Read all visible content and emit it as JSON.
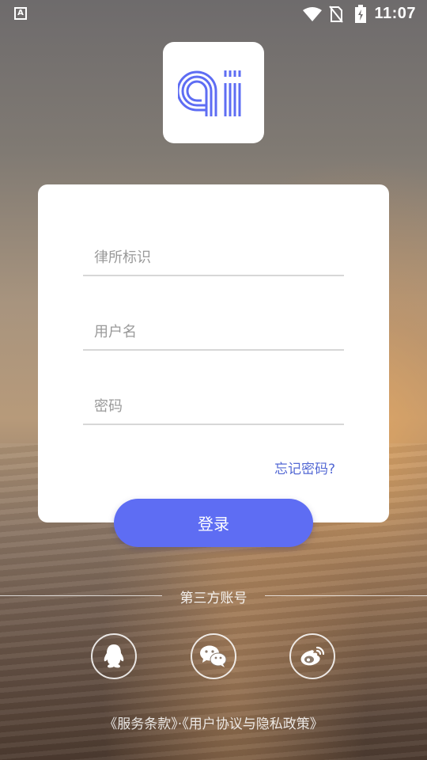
{
  "status_bar": {
    "notification_icon": "a-icon",
    "time": "11:07",
    "icons": [
      "wifi-icon",
      "no-sim-icon",
      "battery-charging-icon"
    ]
  },
  "logo": {
    "icon": "ai-logo-icon",
    "brand_color": "#5e6df3"
  },
  "form": {
    "firm_id_placeholder": "律所标识",
    "username_placeholder": "用户名",
    "password_placeholder": "密码",
    "forgot_password": "忘记密码?"
  },
  "login_button": "登录",
  "third_party": {
    "label": "第三方账号",
    "providers": [
      "qq-icon",
      "wechat-icon",
      "weibo-icon"
    ]
  },
  "terms": {
    "service_terms": "《服务条款》",
    "separator": "·",
    "privacy": "《用户协议与隐私政策》"
  },
  "colors": {
    "accent": "#5e6df3",
    "link": "#5469d4"
  }
}
